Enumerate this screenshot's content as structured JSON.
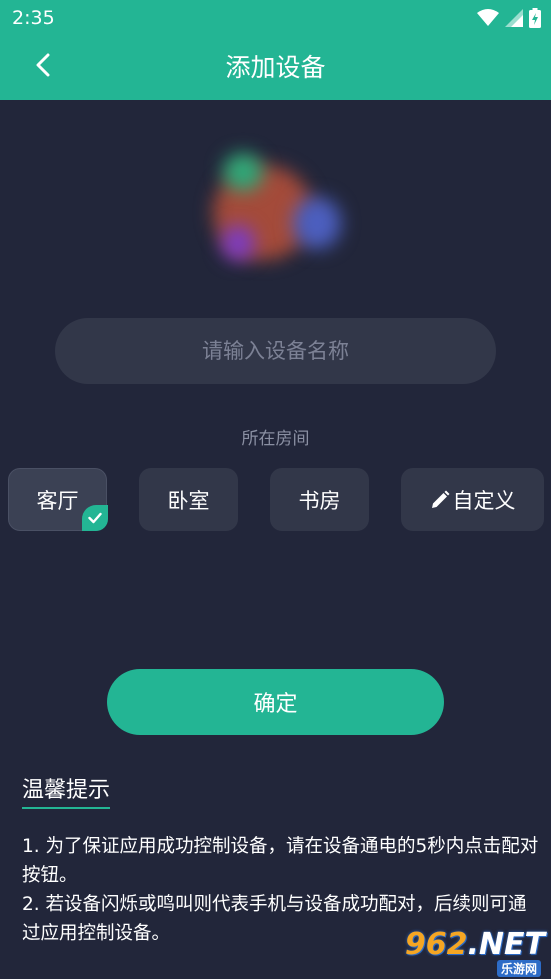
{
  "status_bar": {
    "time": "2:35",
    "icons": [
      "wifi-icon",
      "signal-icon",
      "battery-charging-icon"
    ]
  },
  "header": {
    "title": "添加设备",
    "back_icon": "chevron-left-icon"
  },
  "device_image": "blurred-device-photo",
  "name_input": {
    "placeholder": "请输入设备名称",
    "value": ""
  },
  "room": {
    "label": "所在房间",
    "options": [
      {
        "label": "客厅",
        "selected": true
      },
      {
        "label": "卧室",
        "selected": false
      },
      {
        "label": "书房",
        "selected": false
      },
      {
        "label": "自定义",
        "selected": false,
        "icon": "pencil-icon"
      }
    ]
  },
  "confirm_label": "确定",
  "tips": {
    "title": "温馨提示",
    "items": [
      "1. 为了保证应用成功控制设备，请在设备通电的5秒内点击配对按钮。",
      "2. 若设备闪烁或鸣叫则代表手机与设备成功配对，后续则可通过应用控制设备。"
    ]
  },
  "watermark": {
    "text_a": "9",
    "text_b": "62",
    "text_c": ".NET",
    "sub": "乐游网"
  },
  "colors": {
    "accent": "#23b594",
    "background": "#22263a",
    "surface": "#323749",
    "muted_text": "#8a8fa2"
  }
}
